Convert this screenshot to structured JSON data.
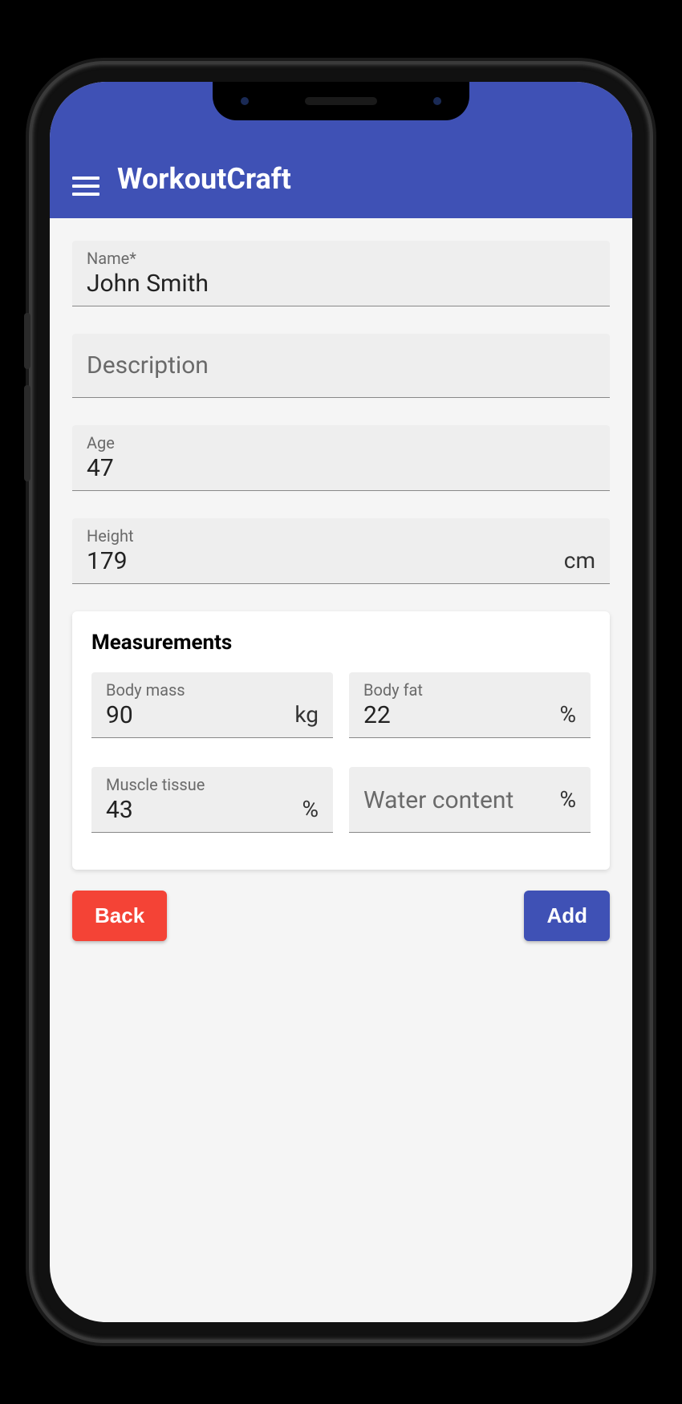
{
  "app": {
    "title": "WorkoutCraft"
  },
  "form": {
    "name": {
      "label": "Name*",
      "value": "John Smith"
    },
    "description": {
      "placeholder": "Description",
      "value": ""
    },
    "age": {
      "label": "Age",
      "value": "47"
    },
    "height": {
      "label": "Height",
      "value": "179",
      "unit": "cm"
    }
  },
  "measurements": {
    "title": "Measurements",
    "body_mass": {
      "label": "Body mass",
      "value": "90",
      "unit": "kg"
    },
    "body_fat": {
      "label": "Body fat",
      "value": "22",
      "unit": "%"
    },
    "muscle_tissue": {
      "label": "Muscle tissue",
      "value": "43",
      "unit": "%"
    },
    "water_content": {
      "placeholder": "Water content",
      "value": "",
      "unit": "%"
    }
  },
  "buttons": {
    "back": "Back",
    "add": "Add"
  },
  "colors": {
    "primary": "#3f51b5",
    "danger": "#f44336",
    "field_bg": "#eeeeee"
  }
}
